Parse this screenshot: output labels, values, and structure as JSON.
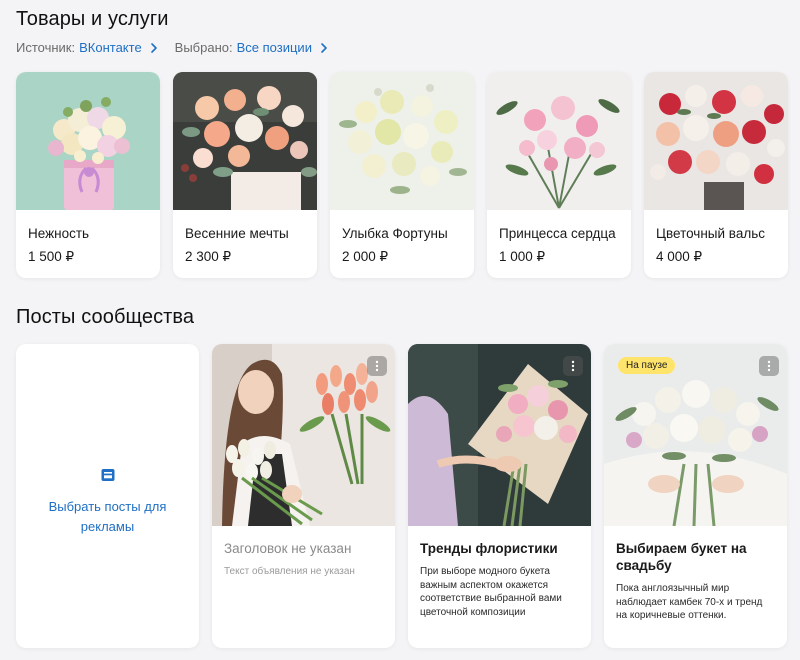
{
  "sections": {
    "products_title": "Товары и услуги",
    "posts_title": "Посты сообщества"
  },
  "filters": {
    "source_label": "Источник:",
    "source_value": "ВКонтакте",
    "selected_label": "Выбрано:",
    "selected_value": "Все позиции"
  },
  "products": [
    {
      "name": "Нежность",
      "price": "1 500 ₽"
    },
    {
      "name": "Весенние мечты",
      "price": "2 300 ₽"
    },
    {
      "name": "Улыбка Фортуны",
      "price": "2 000 ₽"
    },
    {
      "name": "Принцесса сердца",
      "price": "1 000 ₽"
    },
    {
      "name": "Цветочный вальс",
      "price": "4 000 ₽"
    }
  ],
  "add_posts": {
    "label": "Выбрать посты для рекламы",
    "icon": "image-icon"
  },
  "posts": [
    {
      "title": "Заголовок не указан",
      "body": "Текст объявления не указан"
    },
    {
      "title": "Тренды флористики",
      "body": "При выборе модного букета важным аспектом окажется соответствие выбранной вами цветочной композиции"
    },
    {
      "title": "Выбираем букет на свадьбу",
      "body": "Пока англоязычный мир наблюдает камбек 70-х и тренд на коричневые оттенки.",
      "badge": "На паузе"
    }
  ],
  "colors": {
    "accent": "#1f6fc4",
    "badge": "#ffe46b",
    "background": "#f4f4f6"
  }
}
